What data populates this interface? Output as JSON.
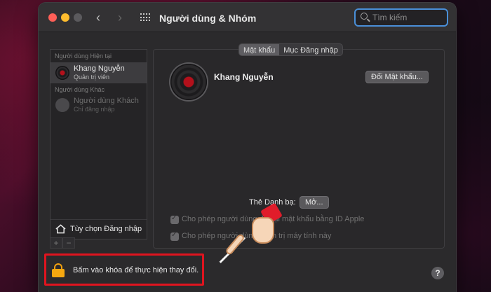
{
  "window": {
    "title": "Người dùng & Nhóm",
    "search_placeholder": "Tìm kiếm"
  },
  "sidebar": {
    "current_section": "Người dùng Hiện tại",
    "current_user": {
      "name": "Khang Nguyễn",
      "role": "Quản trị viên"
    },
    "other_section": "Người dùng Khác",
    "guest_user": {
      "name": "Người dùng Khách",
      "role": "Chỉ đăng nhập"
    },
    "login_options": "Tùy chọn Đăng nhập",
    "add_label": "+",
    "remove_label": "−"
  },
  "tabs": [
    {
      "label": "Mật khẩu",
      "active": true
    },
    {
      "label": "Mục Đăng nhập",
      "active": false
    }
  ],
  "main": {
    "username": "Khang Nguyễn",
    "change_password": "Đổi Mật khẩu...",
    "card_label": "Thẻ Danh bạ:",
    "open_button": "Mở...",
    "checkbox1": "Cho phép người dùng đặt lại mật khẩu bằng ID Apple",
    "checkbox2": "Cho phép người dùng quản trị máy tính này"
  },
  "footer": {
    "lock_text": "Bấm vào khóa để thực hiện thay đổi.",
    "help": "?"
  },
  "colors": {
    "highlight": "#e0141f",
    "lock": "#f5a810",
    "search_focus": "#4a8fd8"
  }
}
